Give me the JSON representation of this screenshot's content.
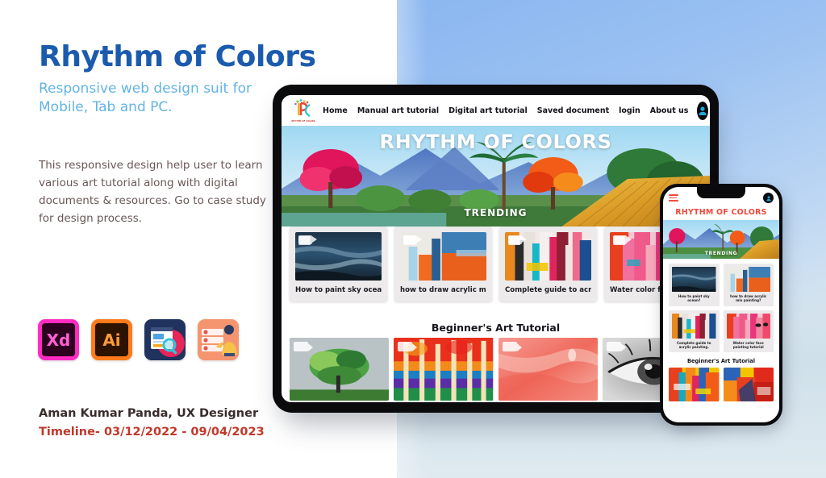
{
  "page": {
    "title": "Rhythm of Colors",
    "subtitle": "Responsive web design suit for Mobile, Tab and PC.",
    "description": "This responsive design help user to learn various art tutorial along with digital documents & resources. Go to case study for design process.",
    "credit_name": "Aman Kumar Panda, UX Designer",
    "credit_timeline": "Timeline- 03/12/2022 - 09/04/2023"
  },
  "colors": {
    "title_blue": "#1b5bae",
    "subtitle_blue": "#63b4e4",
    "body_text": "#6b5757",
    "timeline_red": "#c0392b",
    "phone_brand_red": "#f0493c",
    "background_blue": "#8ab6f0"
  },
  "tools": [
    {
      "name": "adobe-xd",
      "label": "Xd"
    },
    {
      "name": "adobe-illustrator",
      "label": "Ai"
    },
    {
      "name": "research-analysis",
      "label": ""
    },
    {
      "name": "user-testing",
      "label": ""
    }
  ],
  "tablet": {
    "logo_caption": "RHYTHM OF COLORS",
    "nav": [
      {
        "label": "Home"
      },
      {
        "label": "Manual art tutorial"
      },
      {
        "label": "Digital art tutorial"
      },
      {
        "label": "Saved document"
      },
      {
        "label": "login"
      },
      {
        "label": "About us"
      }
    ],
    "hero": {
      "title": "RHYTHM OF COLORS",
      "subtitle": "TRENDING"
    },
    "trending_cards": [
      {
        "label": "How to paint sky ocean?",
        "art": "ocean"
      },
      {
        "label": "how to draw acrylic mix painting?",
        "art": "acrylic-mix"
      },
      {
        "label": "Complete guide to acrylic painting.",
        "art": "acrylic-abstract"
      },
      {
        "label": "Water color face painting tutorial",
        "art": "face-abstract"
      }
    ],
    "section_title": "Beginner's Art Tutorial",
    "beginner_items": [
      {
        "art": "tree"
      },
      {
        "art": "birch-forest"
      },
      {
        "art": "pink-abstract"
      },
      {
        "art": "eye-sketch"
      }
    ]
  },
  "phone": {
    "brand": "RHYTHM OF COLORS",
    "hero_subtitle": "TRENDING",
    "trending_cards": [
      {
        "label": "How to paint sky ocean?",
        "art": "ocean"
      },
      {
        "label": "how to draw acrylic mix painting?",
        "art": "acrylic-mix"
      },
      {
        "label": "Complete guide to acrylic painting.",
        "art": "acrylic-abstract"
      },
      {
        "label": "Water color face painting tutorial",
        "art": "face-abstract"
      }
    ],
    "section_title": "Beginner's Art Tutorial",
    "beginner_items": [
      {
        "art": "warm-abstract"
      },
      {
        "art": "geometric-abstract"
      }
    ]
  }
}
